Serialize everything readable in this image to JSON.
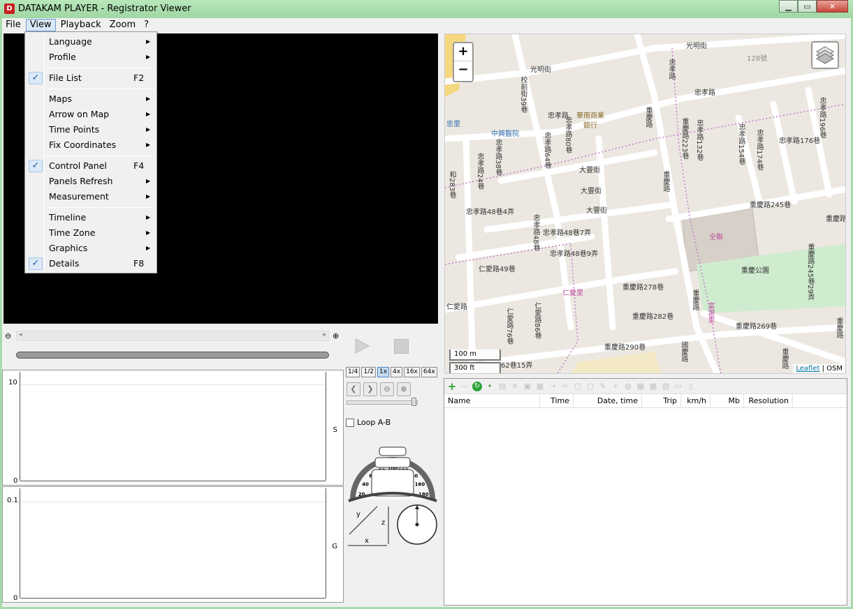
{
  "window": {
    "title": "DATAKAM PLAYER - Registrator Viewer",
    "icon": "app-logo-icon"
  },
  "menubar": {
    "items": [
      "File",
      "View",
      "Playback",
      "Zoom",
      "?"
    ],
    "active": "View"
  },
  "view_menu": {
    "language": "Language",
    "profile": "Profile",
    "file_list": "File List",
    "file_list_key": "F2",
    "maps": "Maps",
    "arrow_on_map": "Arrow on Map",
    "time_points": "Time Points",
    "fix_coordinates": "Fix Coordinates",
    "control_panel": "Control Panel",
    "control_panel_key": "F4",
    "panels_refresh": "Panels Refresh",
    "measurement": "Measurement",
    "timeline": "Timeline",
    "time_zone": "Time Zone",
    "graphics": "Graphics",
    "details": "Details",
    "details_key": "F8",
    "check_mark": "✓"
  },
  "playback": {
    "speeds": [
      "1/4",
      "1/2",
      "1x",
      "4x",
      "16x",
      "64x"
    ],
    "selected_speed": "1x",
    "loop_label": "Loop A-B"
  },
  "graphs": {
    "s": {
      "side_label": "S",
      "y_top": "10",
      "y_bottom": "0"
    },
    "g": {
      "side_label": "G",
      "y_top": "0.1",
      "y_bottom": "0"
    }
  },
  "gauge": {
    "ticks": [
      "0",
      "20",
      "40",
      "60",
      "80",
      "100",
      "120",
      "140",
      "160",
      "180",
      "200"
    ]
  },
  "axes": {
    "x": "x",
    "y": "y",
    "z": "z"
  },
  "map": {
    "zoom_in": "+",
    "zoom_out": "−",
    "scale_m": "100 m",
    "scale_ft": "300 ft",
    "attribution_link": "Leaflet",
    "attribution_sep": " | ",
    "attribution_src": "OSM",
    "labels": {
      "guangming_st_top": "光明街",
      "no128": "128號",
      "guangming_st": "光明街",
      "xiaolu_39": "校前街39巷",
      "zhongxiao_rd_top": "忠孝路",
      "zhongxiao_rd": "忠孝路",
      "zhongxiao_rd_2": "忠孝路",
      "hnb_bank": "華南商業",
      "hnb_bank2": "銀行",
      "zhongxing_hosp": "中興醫院",
      "zhongxiao_80": "忠孝路80巷",
      "zhongxiao_64": "忠孝路64巷",
      "zhongxiao_38": "忠孝路38巷",
      "zhongxiao_24": "忠孝路24巷",
      "chongqing_223": "重慶路223巷",
      "zhongxiao_132": "忠孝路132巷",
      "zhongxiao_154": "忠孝路154巷",
      "zhongxiao_174": "忠孝路174巷",
      "zhongxiao_176": "忠孝路176巷",
      "zhongxiao_196": "忠孝路196巷",
      "dafeng_1": "大豐街",
      "dafeng_2": "大豐街",
      "dafeng_3": "大豐街",
      "chongqing_rd": "重慶路",
      "chongqing_rd_2": "重慶路",
      "chongqing_rd_3": "重慶路",
      "chongqing_245": "重慶路245巷",
      "chongqing_rd_right": "重慶路",
      "zhongxiao_48_4": "忠孝路48巷4弄",
      "zhongxiao_48_7": "忠孝路48巷7弄",
      "zhongxiao_48_9": "忠孝路48巷9弄",
      "zhongxiao_48": "忠孝路48巷",
      "quanlian": "全聯",
      "chongqing_park": "重慶公園",
      "chongqing_245_29": "重慶路245巷29弄",
      "renai_49": "仁愛路49巷",
      "renai_li": "仁愛里",
      "chongqing_278": "重慶路278巷",
      "chongqing_282": "重慶路282巷",
      "renai_rd": "仁愛路",
      "renai_86": "仁愛路86巷",
      "renai_76": "仁愛路76巷",
      "chongqing_269": "重慶路269巷",
      "chongqing_290": "重慶路290巷",
      "guoqing_rd": "國慶路",
      "lane_62_15": "62巷15弄",
      "fuyuan": "富源里",
      "he283": "和283巷",
      "zhong_li": "忠里",
      "right_edge_2": "重慶路",
      "right_edge_3": "重慶路"
    }
  },
  "file_list": {
    "columns": [
      "Name",
      "Time",
      "Date, time",
      "Trip",
      "km/h",
      "Mb",
      "Resolution"
    ],
    "rows": []
  },
  "colors": {
    "frame": "#a6dca9",
    "menu_bg": "#f0f0f0",
    "accent": "#4e88c4",
    "map_bg": "#ece8e1"
  }
}
